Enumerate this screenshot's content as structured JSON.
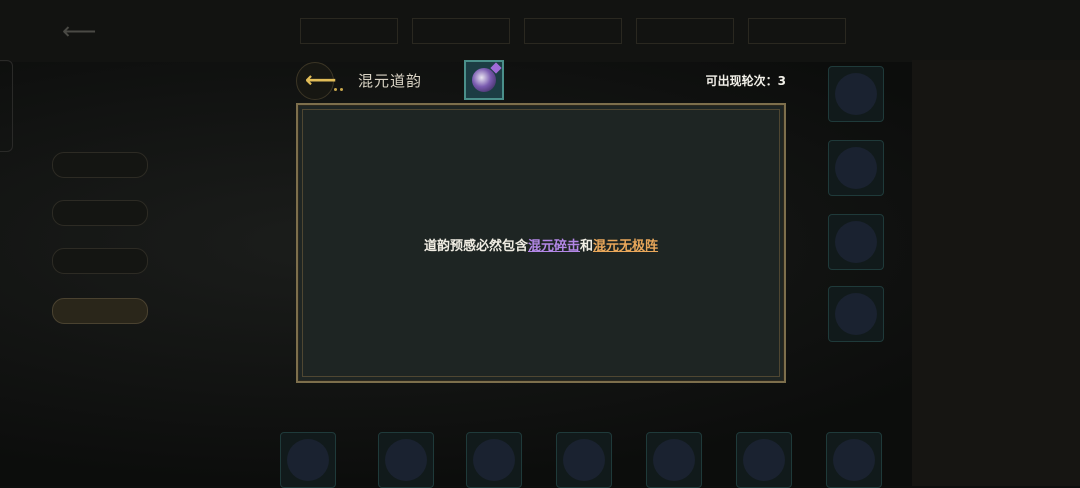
{
  "header": {
    "title": "混元道韵",
    "appear_label": "可出现轮次：",
    "appear_value": "3",
    "skill_icon": "chaos-orb-icon",
    "back_icon": "golden-arrow-back-icon"
  },
  "description": {
    "prefix": "道韵预感必然包含",
    "keyword1": "混元碎击",
    "connector": "和",
    "keyword2": "混元无极阵"
  },
  "colors": {
    "accent_gold": "#e2bd58",
    "keyword_purple": "#b387e6",
    "keyword_orange": "#e9a75a",
    "modal_bg": "#1e2523",
    "modal_border": "#7d6f4c"
  }
}
